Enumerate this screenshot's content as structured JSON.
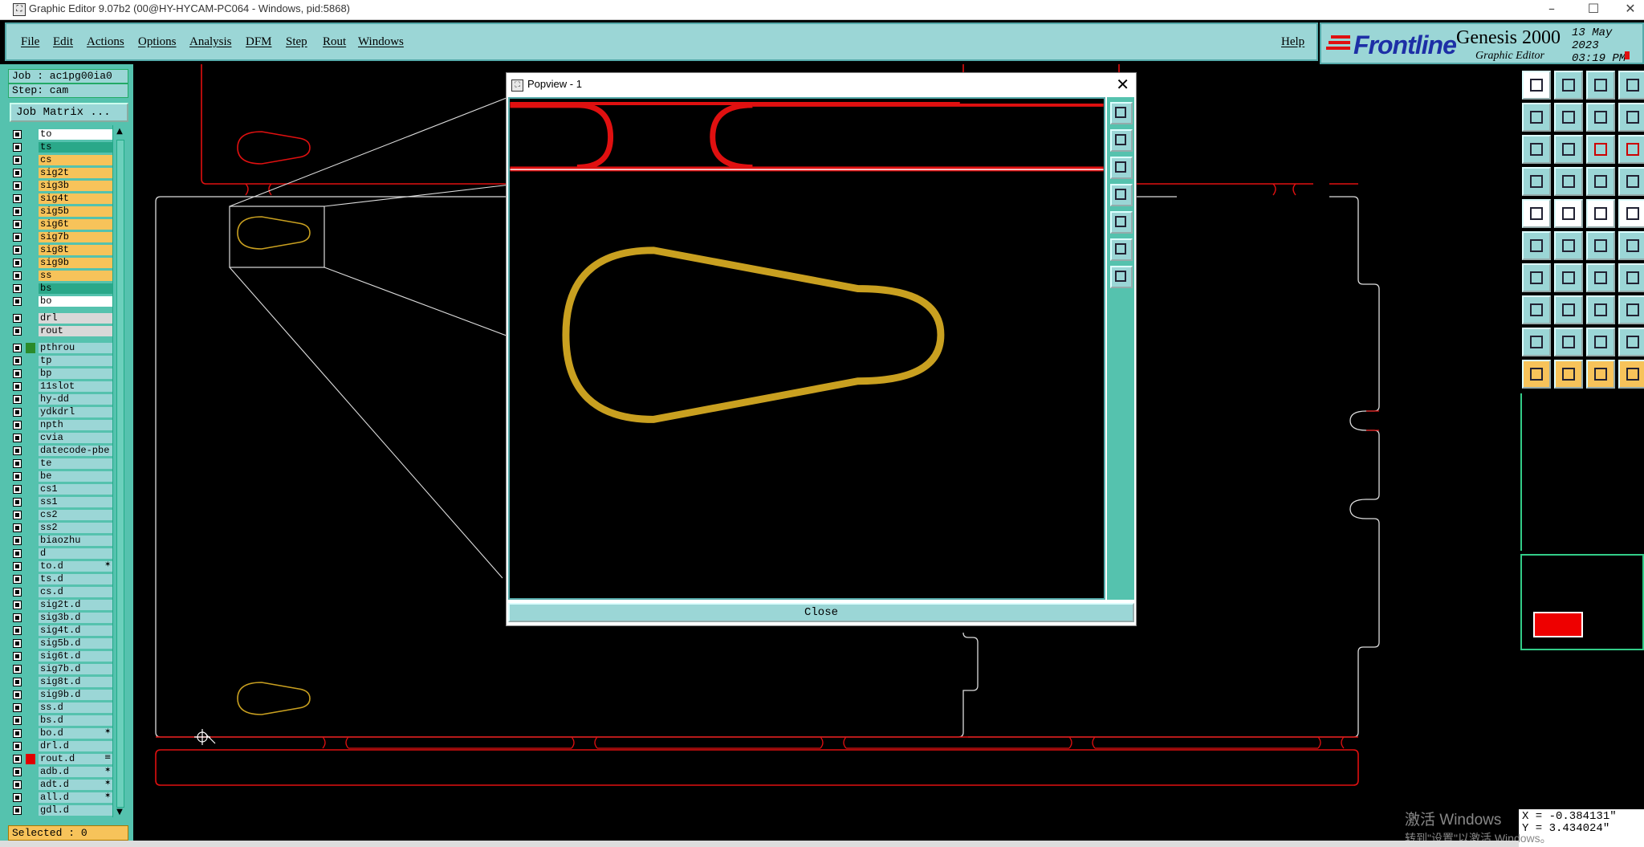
{
  "window": {
    "title": "Graphic Editor 9.07b2 (00@HY-HYCAM-PC064 - Windows, pid:5868)"
  },
  "menu": {
    "items": [
      "File",
      "Edit",
      "Actions",
      "Options",
      "Analysis",
      "DFM",
      "Step",
      "Rout",
      "Windows"
    ],
    "help": "Help"
  },
  "logo": {
    "brand": "Frontline",
    "product": "Genesis 2000",
    "subtitle": "Graphic Editor",
    "date": "13 May 2023",
    "time": "03:19 PM"
  },
  "job": {
    "label": "Job : ac1pg00ia0",
    "step": "Step: cam",
    "matrix_button": "Job Matrix ..."
  },
  "layers": [
    {
      "name": "to",
      "bg": "#ffffff"
    },
    {
      "name": "ts",
      "bg": "#2aa889"
    },
    {
      "name": "cs",
      "bg": "#f7c35a"
    },
    {
      "name": "sig2t",
      "bg": "#f7c35a"
    },
    {
      "name": "sig3b",
      "bg": "#f7c35a"
    },
    {
      "name": "sig4t",
      "bg": "#f7c35a"
    },
    {
      "name": "sig5b",
      "bg": "#f7c35a"
    },
    {
      "name": "sig6t",
      "bg": "#f7c35a"
    },
    {
      "name": "sig7b",
      "bg": "#f7c35a"
    },
    {
      "name": "sig8t",
      "bg": "#f7c35a"
    },
    {
      "name": "sig9b",
      "bg": "#f7c35a"
    },
    {
      "name": "ss",
      "bg": "#f7c35a"
    },
    {
      "name": "bs",
      "bg": "#2aa889"
    },
    {
      "name": "bo",
      "bg": "#ffffff"
    },
    {
      "name": "drl",
      "bg": "#d8d8d8",
      "gap": true
    },
    {
      "name": "rout",
      "bg": "#d8d8d8"
    },
    {
      "name": "pthrou",
      "bg": "#9bd6d6",
      "gap": true,
      "swatch": "#2a8a2a"
    },
    {
      "name": "tp",
      "bg": "#9bd6d6"
    },
    {
      "name": "bp",
      "bg": "#9bd6d6"
    },
    {
      "name": "11slot",
      "bg": "#9bd6d6"
    },
    {
      "name": "hy-dd",
      "bg": "#9bd6d6"
    },
    {
      "name": "ydkdrl",
      "bg": "#9bd6d6"
    },
    {
      "name": "npth",
      "bg": "#9bd6d6"
    },
    {
      "name": "cvia",
      "bg": "#9bd6d6"
    },
    {
      "name": "datecode-pbe",
      "bg": "#9bd6d6"
    },
    {
      "name": "te",
      "bg": "#9bd6d6"
    },
    {
      "name": "be",
      "bg": "#9bd6d6"
    },
    {
      "name": "cs1",
      "bg": "#9bd6d6"
    },
    {
      "name": "ss1",
      "bg": "#9bd6d6"
    },
    {
      "name": "cs2",
      "bg": "#9bd6d6"
    },
    {
      "name": "ss2",
      "bg": "#9bd6d6"
    },
    {
      "name": "biaozhu",
      "bg": "#9bd6d6"
    },
    {
      "name": "d",
      "bg": "#9bd6d6"
    },
    {
      "name": "to.d",
      "bg": "#9bd6d6",
      "mark": "✶"
    },
    {
      "name": "ts.d",
      "bg": "#9bd6d6"
    },
    {
      "name": "cs.d",
      "bg": "#9bd6d6"
    },
    {
      "name": "sig2t.d",
      "bg": "#9bd6d6"
    },
    {
      "name": "sig3b.d",
      "bg": "#9bd6d6"
    },
    {
      "name": "sig4t.d",
      "bg": "#9bd6d6"
    },
    {
      "name": "sig5b.d",
      "bg": "#9bd6d6"
    },
    {
      "name": "sig6t.d",
      "bg": "#9bd6d6"
    },
    {
      "name": "sig7b.d",
      "bg": "#9bd6d6"
    },
    {
      "name": "sig8t.d",
      "bg": "#9bd6d6"
    },
    {
      "name": "sig9b.d",
      "bg": "#9bd6d6"
    },
    {
      "name": "ss.d",
      "bg": "#9bd6d6"
    },
    {
      "name": "bs.d",
      "bg": "#9bd6d6"
    },
    {
      "name": "bo.d",
      "bg": "#9bd6d6",
      "mark": "✶"
    },
    {
      "name": "drl.d",
      "bg": "#9bd6d6"
    },
    {
      "name": "rout.d",
      "bg": "#9bd6d6",
      "swatch": "#e00000",
      "mark": "≡"
    },
    {
      "name": "adb.d",
      "bg": "#9bd6d6",
      "mark": "✶"
    },
    {
      "name": "adt.d",
      "bg": "#9bd6d6",
      "mark": "✶"
    },
    {
      "name": "all.d",
      "bg": "#9bd6d6",
      "mark": "✶"
    },
    {
      "name": "gdl.d",
      "bg": "#9bd6d6"
    }
  ],
  "selected": "Selected : 0",
  "popview": {
    "title": "Popview - 1",
    "close_label": "Close"
  },
  "coords": {
    "x": "X = -0.384131\"",
    "y": "Y = 3.434024\""
  },
  "watermark": {
    "line1": "激活 Windows",
    "line2": "转到\"设置\"以激活 Windows。"
  },
  "colors": {
    "outline": "#e01010",
    "feature": "#c9a020",
    "panel": "#9bd6d6",
    "panel_dark": "#55c2ae"
  }
}
